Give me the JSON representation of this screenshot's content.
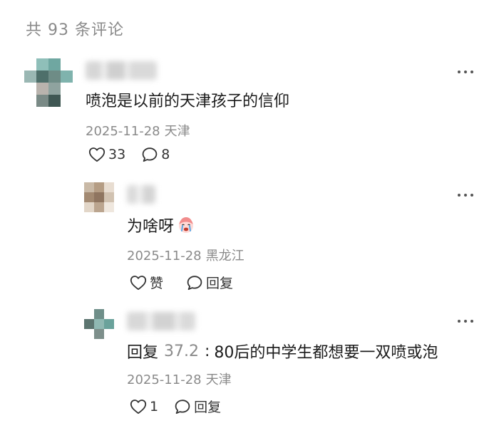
{
  "header": {
    "count_label": "共 93 条评论"
  },
  "comments": [
    {
      "text": "喷泡是以前的天津孩子的信仰",
      "date": "2025-11-28",
      "location": "天津",
      "likes": "33",
      "replies": "8",
      "avatar_colors": [
        "#ffffff",
        "#8fbfb9",
        "#6fa7a1",
        "#ffffff",
        "#9ab7b3",
        "#4e6f6a",
        "#6e8c86",
        "#7fb3ad",
        "#ffffff",
        "#b9b3ad",
        "#8fa39f",
        "#ffffff",
        "#ffffff",
        "#7a8a86",
        "#3f5753",
        "#ffffff"
      ]
    },
    {
      "text": "为啥呀",
      "date": "2025-11-28",
      "location": "黑龙江",
      "like_label": "赞",
      "reply_label": "回复",
      "avatar_colors": [
        "#c9b9a6",
        "#b59d84",
        "#e8ddd1",
        "#a38a72",
        "#8f7560",
        "#d1c2b1",
        "#e2d6c8",
        "#bba58f",
        "#efe7de"
      ]
    },
    {
      "reply_prefix": "回复",
      "mention": "37.2",
      "colon": ":",
      "text": "80后的中学生都想要一双喷或泡",
      "date": "2025-11-28",
      "location": "天津",
      "likes": "1",
      "reply_label": "回复",
      "avatar_colors": [
        "#ffffff",
        "#6f8f89",
        "#ffffff",
        "#5c7570",
        "#8fb8b2",
        "#6aa29b",
        "#ffffff",
        "#7d8f8b",
        "#ffffff"
      ]
    }
  ],
  "icons": {
    "more": "more-horizontal-icon",
    "like": "heart-outline-icon",
    "reply": "speech-bubble-icon",
    "emoji": "crying-face-emoji"
  }
}
